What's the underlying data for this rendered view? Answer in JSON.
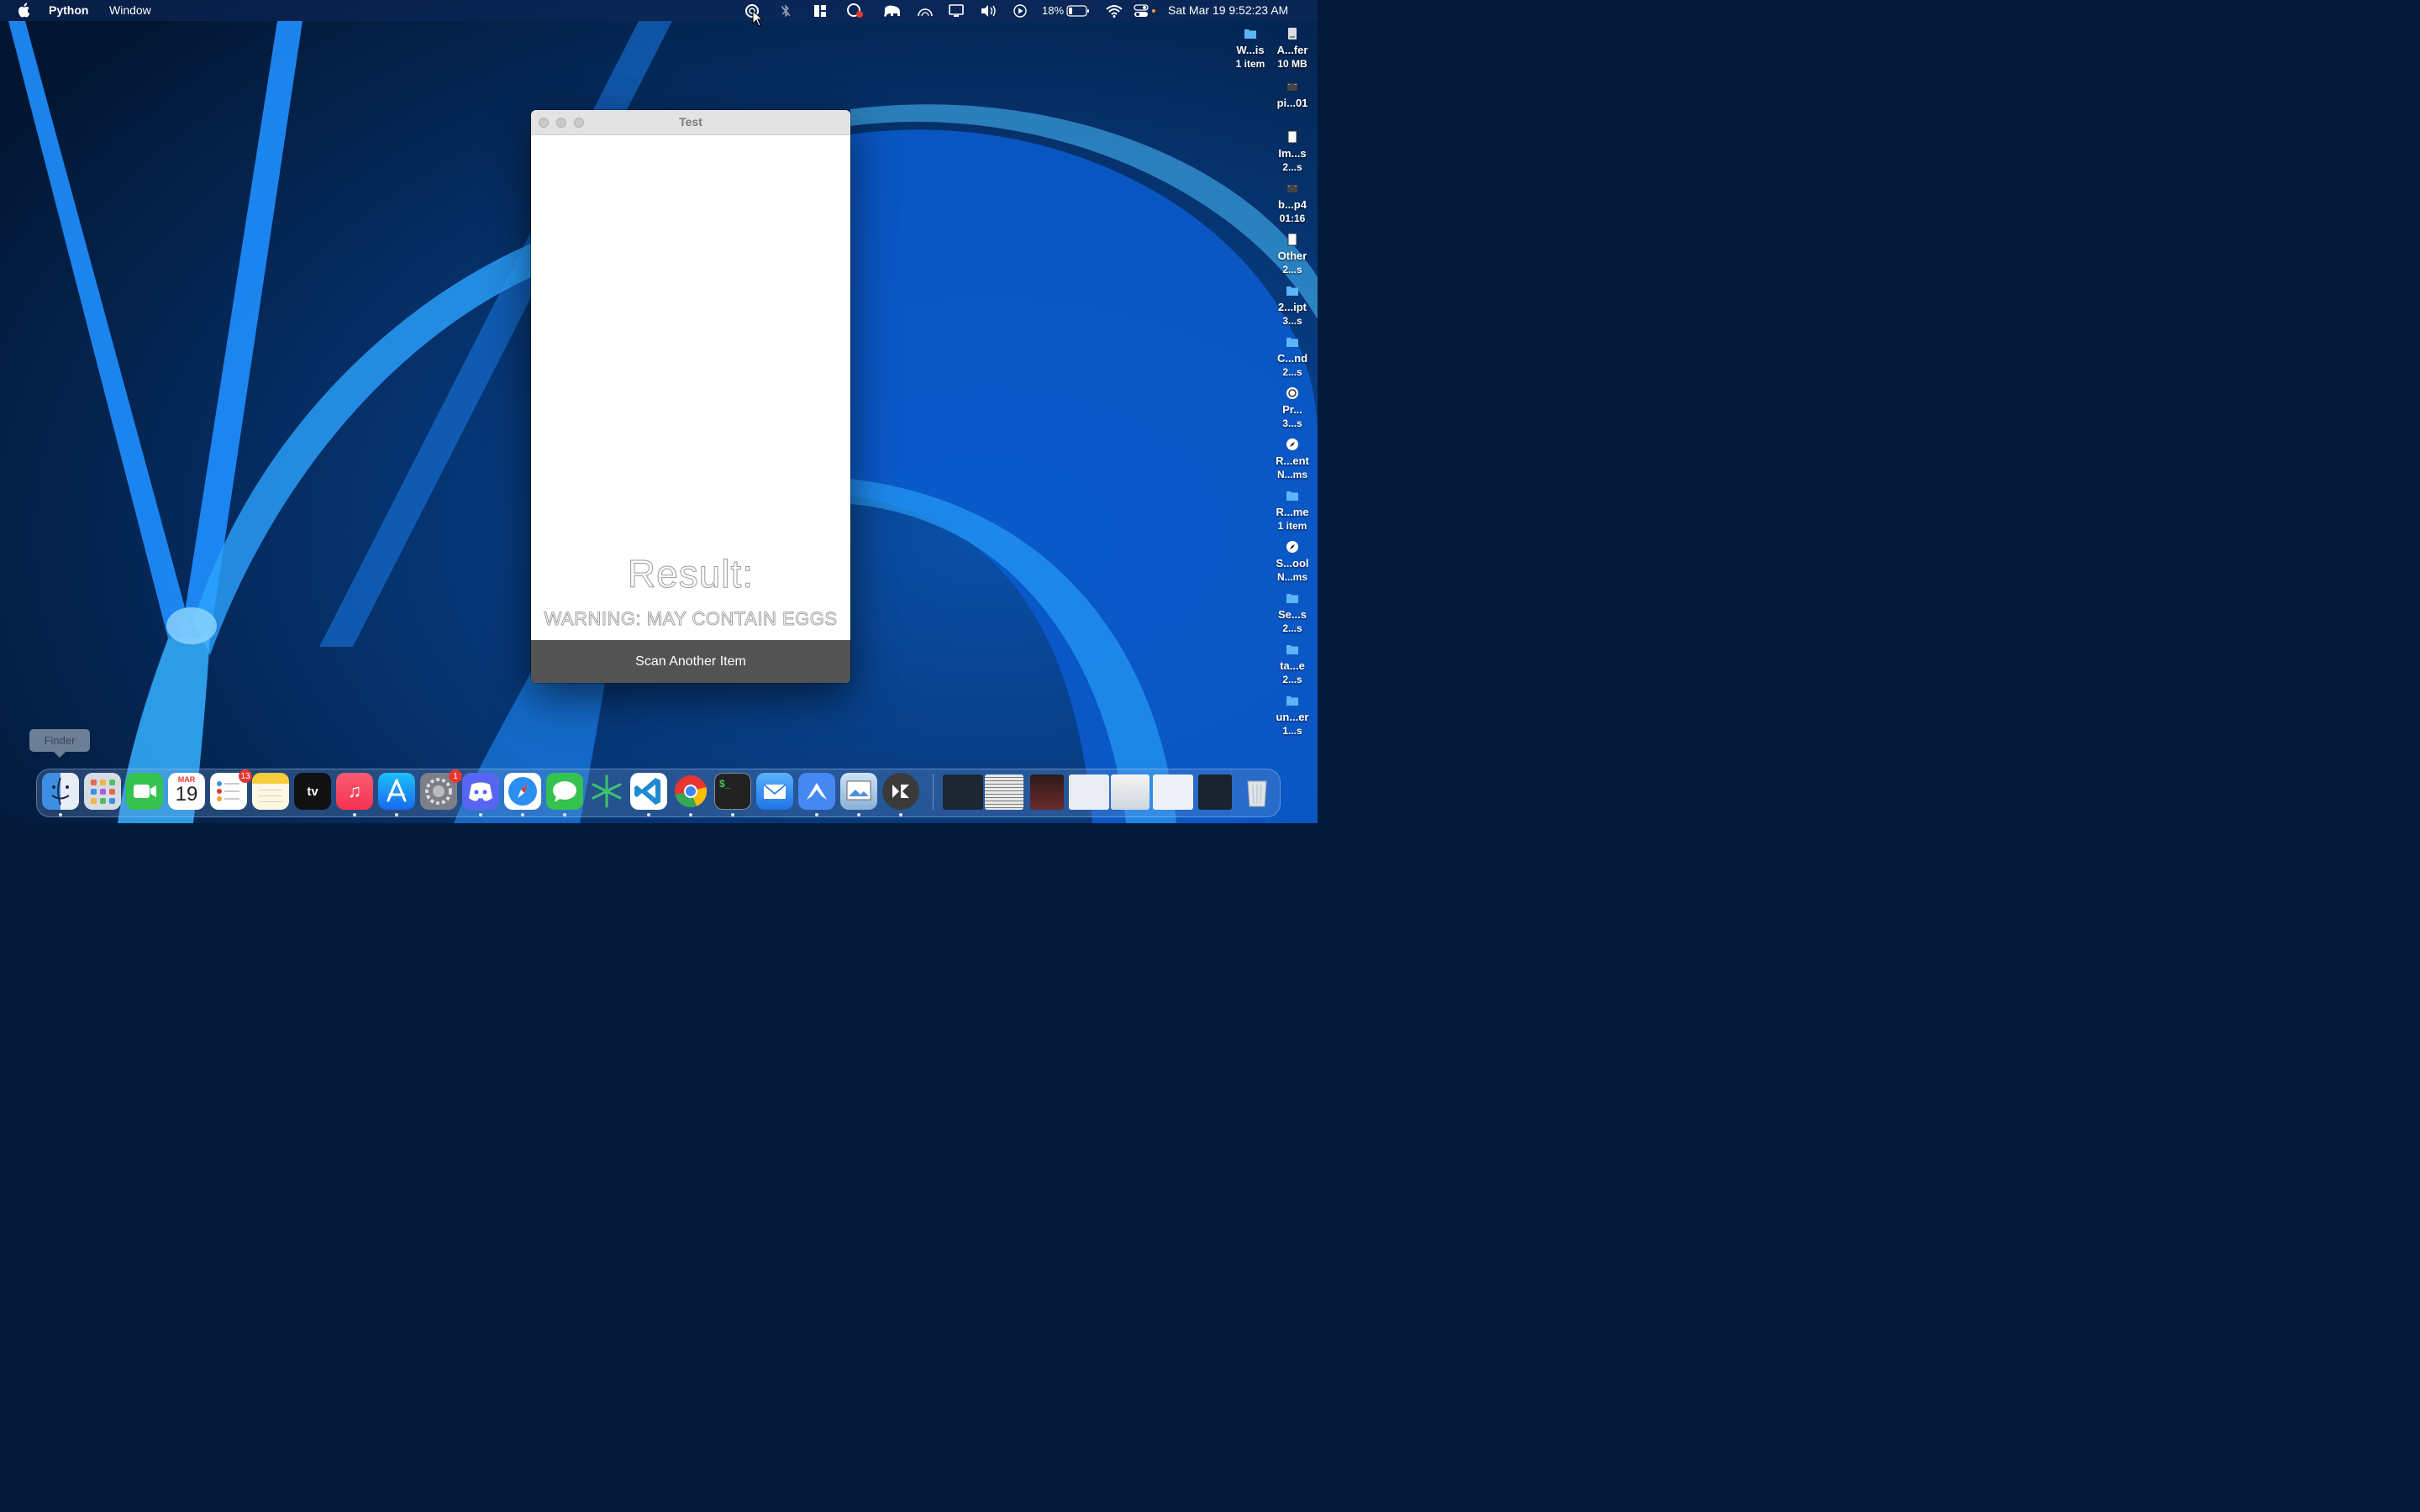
{
  "menubar": {
    "app_name": "Python",
    "window_menu": "Window",
    "battery_percent": "18%",
    "clock": "Sat Mar 19  9:52:23 AM",
    "status_icons": [
      "magnifier-icon",
      "bluetooth-off-icon",
      "layout-icon",
      "recorder-icon",
      "elephant-icon",
      "gauge-icon",
      "display-icon",
      "volume-icon",
      "play-icon",
      "battery-icon",
      "wifi-icon",
      "control-center-icon"
    ]
  },
  "window": {
    "title": "Test",
    "result_label": "Result:",
    "warning_text": "WARNING: MAY CONTAIN EGGS",
    "button_label": "Scan Another Item"
  },
  "desktop_items": [
    {
      "name": "W...is",
      "sub": "1 item",
      "icon": "folder-icon"
    },
    {
      "name": "A...fer",
      "sub": "10 MB",
      "icon": "disk-image-icon"
    },
    {
      "name": "pi...01",
      "sub": "",
      "icon": "video-file-icon"
    },
    {
      "name": "Im...s",
      "sub": "2...s",
      "icon": "document-icon"
    },
    {
      "name": "b...p4",
      "sub": "01:16",
      "icon": "video-file-icon"
    },
    {
      "name": "Other",
      "sub": "2...s",
      "icon": "document-icon"
    },
    {
      "name": "2...ipt",
      "sub": "3...s",
      "icon": "folder-icon"
    },
    {
      "name": "C...nd",
      "sub": "2...s",
      "icon": "folder-icon"
    },
    {
      "name": "Pr...",
      "sub": "3...s",
      "icon": "app-icon"
    },
    {
      "name": "R...ent",
      "sub": "N...ms",
      "icon": "safari-file-icon"
    },
    {
      "name": "R...me",
      "sub": "1 item",
      "icon": "folder-icon"
    },
    {
      "name": "S...ool",
      "sub": "N...ms",
      "icon": "safari-file-icon"
    },
    {
      "name": "Se...s",
      "sub": "2...s",
      "icon": "folder-icon"
    },
    {
      "name": "ta...e",
      "sub": "2...s",
      "icon": "folder-icon"
    },
    {
      "name": "un...er",
      "sub": "1...s",
      "icon": "folder-icon"
    }
  ],
  "tooltip": "Finder",
  "dock": {
    "calendar_month": "MAR",
    "calendar_day": "19",
    "reminders_badge": "13",
    "settings_badge": "1",
    "apps": [
      "Finder",
      "Launchpad",
      "FaceTime",
      "Calendar",
      "Reminders",
      "Notes",
      "TV",
      "Music",
      "App Store",
      "System Preferences",
      "Discord",
      "Safari",
      "Messages",
      "Perplexity",
      "Visual Studio Code",
      "Chrome",
      "Terminal",
      "Mail",
      "NordVPN",
      "Preview",
      "Kivy"
    ]
  },
  "colors": {
    "window_button_bg": "#535353",
    "titlebar_bg": "#e3e3e3",
    "wallpaper_accent": "#1e8cff"
  }
}
